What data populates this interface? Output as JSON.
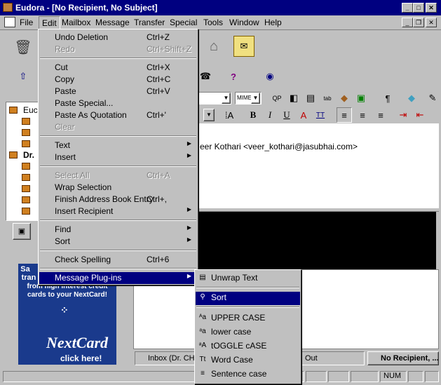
{
  "window": {
    "title": "Eudora - [No Recipient, No Subject]"
  },
  "menubar": {
    "items": [
      "File",
      "Edit",
      "Mailbox",
      "Message",
      "Transfer",
      "Special",
      "Tools",
      "Window",
      "Help"
    ]
  },
  "edit_menu": {
    "items": [
      {
        "label": "Undo Deletion",
        "shortcut": "Ctrl+Z",
        "disabled": false
      },
      {
        "label": "Redo",
        "shortcut": "Ctrl+Shift+Z",
        "disabled": true
      },
      {
        "label": "Cut",
        "shortcut": "Ctrl+X",
        "disabled": false
      },
      {
        "label": "Copy",
        "shortcut": "Ctrl+C",
        "disabled": false
      },
      {
        "label": "Paste",
        "shortcut": "Ctrl+V",
        "disabled": false
      },
      {
        "label": "Paste Special...",
        "shortcut": "",
        "disabled": false
      },
      {
        "label": "Paste As Quotation",
        "shortcut": "Ctrl+'",
        "disabled": false
      },
      {
        "label": "Clear",
        "shortcut": "",
        "disabled": true
      },
      {
        "label": "Text",
        "shortcut": "",
        "disabled": false,
        "submenu": true
      },
      {
        "label": "Insert",
        "shortcut": "",
        "disabled": false,
        "submenu": true
      },
      {
        "label": "Select All",
        "shortcut": "Ctrl+A",
        "disabled": true
      },
      {
        "label": "Wrap Selection",
        "shortcut": "",
        "disabled": false
      },
      {
        "label": "Finish Address Book Entry",
        "shortcut": "Ctrl+,",
        "disabled": false
      },
      {
        "label": "Insert Recipient",
        "shortcut": "",
        "disabled": false,
        "submenu": true
      },
      {
        "label": "Find",
        "shortcut": "",
        "disabled": false,
        "submenu": true
      },
      {
        "label": "Sort",
        "shortcut": "",
        "disabled": false,
        "submenu": true
      },
      {
        "label": "Check Spelling",
        "shortcut": "Ctrl+6",
        "disabled": false
      },
      {
        "label": "Message Plug-ins",
        "shortcut": "",
        "disabled": false,
        "submenu": true,
        "selected": true
      }
    ]
  },
  "plugins_menu": {
    "items": [
      {
        "label": "Unwrap Text",
        "icon": "unwrap-icon"
      },
      {
        "label": "Sort",
        "icon": "sort-icon",
        "selected": true
      },
      {
        "label": "UPPER CASE",
        "icon": "uppercase-icon"
      },
      {
        "label": "lower case",
        "icon": "lowercase-icon"
      },
      {
        "label": "tOGGLE cASE",
        "icon": "togglecase-icon"
      },
      {
        "label": "Word Case",
        "icon": "wordcase-icon"
      },
      {
        "label": "Sentence case",
        "icon": "sentencecase-icon"
      }
    ]
  },
  "message": {
    "from": "eer Kothari <veer_kothari@jasubhai.com>",
    "mime": "MIME"
  },
  "mailbox_tree": {
    "items": [
      "Euc",
      "Dr."
    ]
  },
  "ad": {
    "line1": "Sa",
    "line2": "tran",
    "line3": "from high interest credit",
    "line4": "cards to your NextCard!",
    "brand": "NextCard",
    "cta": "click here!"
  },
  "tabs": {
    "inbox": "Inbox (Dr. CH",
    "out": "Out",
    "current": "No Recipient, ..."
  },
  "status": {
    "num": "NUM"
  },
  "colors": {
    "titlebar": "#000080",
    "face": "#c0c0c0",
    "highlight": "#000080",
    "ad_bg": "#1a3a8c"
  }
}
